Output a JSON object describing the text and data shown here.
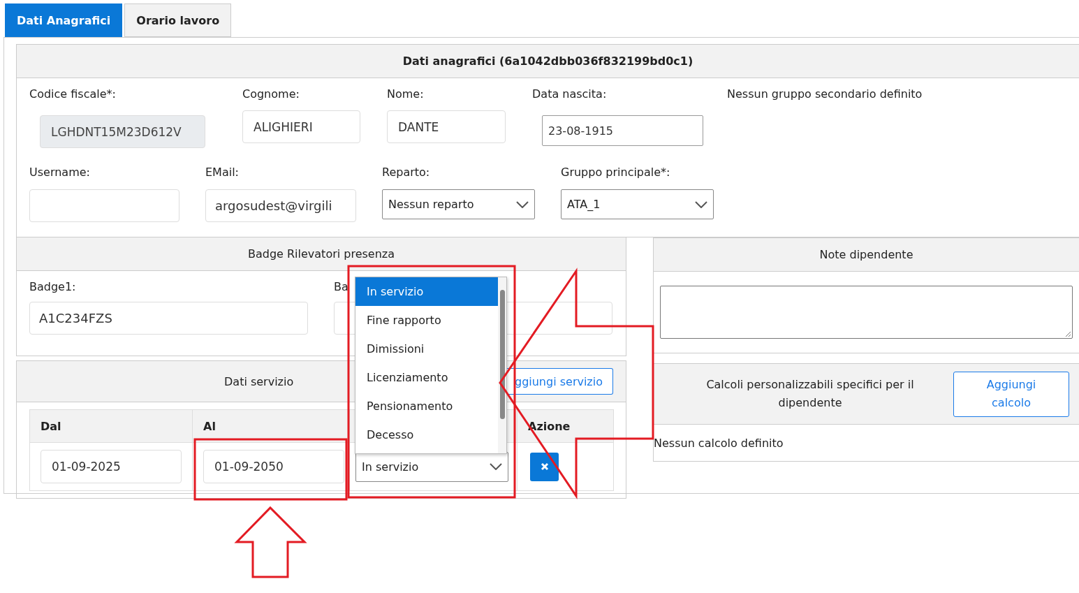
{
  "tabs": [
    {
      "label": "Dati Anagrafici",
      "selected": true
    },
    {
      "label": "Orario lavoro",
      "selected": false
    }
  ],
  "anagrafica": {
    "title": "Dati anagrafici (6a1042dbb036f832199bd0c1)",
    "row_1": [
      {
        "kind": "text",
        "label": "Codice fiscale*:",
        "value": "LGHDNT15M23D612V",
        "disabled": true
      },
      {
        "kind": "text",
        "label": "Cognome:",
        "value": "ALIGHIERI",
        "disabled": false
      },
      {
        "kind": "text",
        "label": "Nome:",
        "value": "DANTE",
        "disabled": false
      },
      {
        "kind": "text",
        "label": "Data nascita:",
        "value": "23-08-1915",
        "disabled": false
      }
    ],
    "secondary_groups": "Nessun gruppo secondario definito",
    "row_2": [
      {
        "kind": "text",
        "label": "Username:",
        "disabled": false
      },
      {
        "kind": "text",
        "label": "EMail:",
        "value": "argosudest@virgili",
        "disabled": false
      },
      {
        "kind": "select",
        "label": "Reparto:",
        "value": "Nessun reparto",
        "disabled": false
      },
      {
        "kind": "select",
        "label": "Gruppo principale*:",
        "value": "ATA_1",
        "disabled": false
      }
    ]
  },
  "badge": {
    "title": "Badge Rilevatori presenza",
    "fields": [
      {
        "label": "Badge1:",
        "value": "A1C234FZS"
      },
      {
        "label": "Ba"
      }
    ]
  },
  "servizio": {
    "title": "Dati servizio",
    "add_button": "ggiungi servizio",
    "columns": [
      "Dal",
      "Al",
      "Azione"
    ],
    "rows": [
      {
        "dal": "01-09-2025",
        "al": "01-09-2050",
        "stato": "In servizio"
      }
    ],
    "dropdown": [
      {
        "label": "In servizio",
        "selected": true
      },
      {
        "label": "Fine rapporto",
        "selected": false
      },
      {
        "label": "Dimissioni",
        "selected": false
      },
      {
        "label": "Licenziamento",
        "selected": false
      },
      {
        "label": "Pensionamento",
        "selected": false
      },
      {
        "label": "Decesso",
        "selected": false
      }
    ]
  },
  "note": {
    "title": "Note dipendente"
  },
  "calcoli": {
    "title": "Calcoli personalizzabili specifici per il dipendente",
    "add_button": "Aggiungi calcolo",
    "empty": "Nessun calcolo definito"
  }
}
